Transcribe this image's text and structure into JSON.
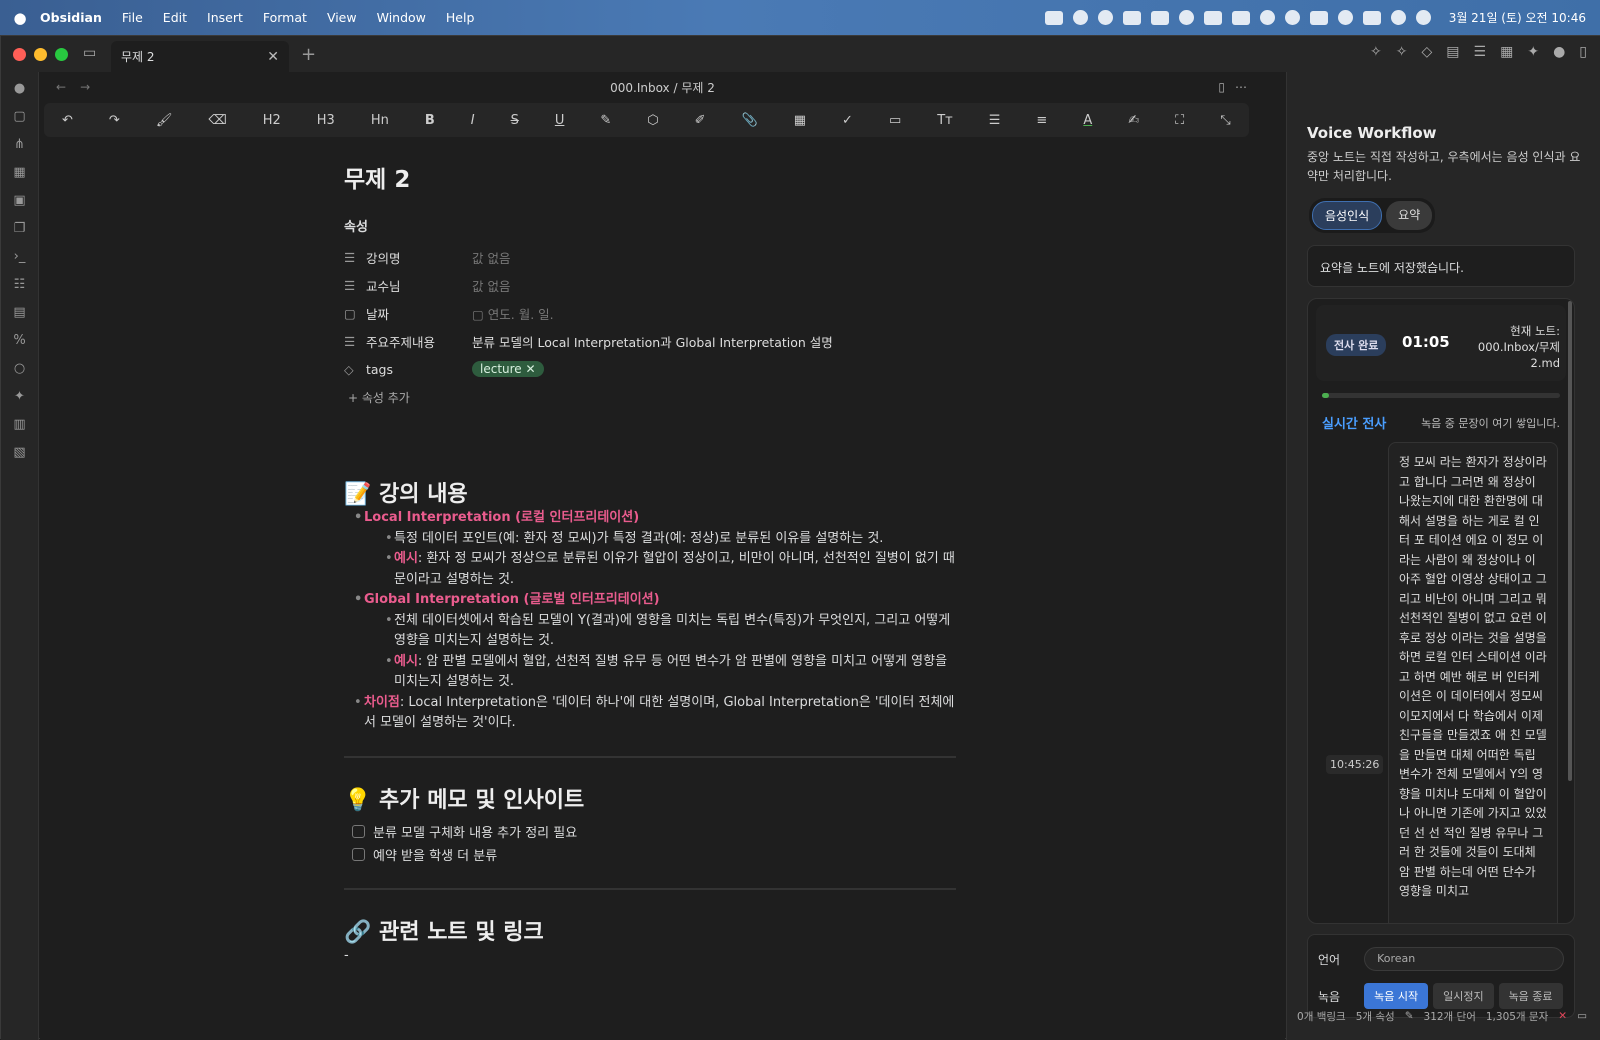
{
  "menubar": {
    "apple": "",
    "app": "Obsidian",
    "items": [
      "File",
      "Edit",
      "Insert",
      "Format",
      "View",
      "Window",
      "Help"
    ],
    "clock": "3월 21일 (토) 오전 10:46"
  },
  "tab": {
    "title": "무제 2",
    "close": "✕",
    "new": "+"
  },
  "nav": {
    "back": "←",
    "forward": "→"
  },
  "breadcrumb": {
    "folder": "000.Inbox",
    "sep": "/",
    "note": "무제 2"
  },
  "toolbar": [
    "↶",
    "↷",
    "🖌",
    "⌫",
    "H2",
    "H3",
    "Hn",
    "B",
    "I",
    "S",
    "U",
    "✎",
    "⬡",
    "✐",
    "📎",
    "▦",
    "✓",
    "▭",
    "Tт",
    "☰",
    "≡",
    "A",
    "✍",
    "⛶",
    "⤡"
  ],
  "note": {
    "title": "무제 2",
    "props_label": "속성",
    "props": [
      {
        "icon": "☰",
        "key": "강의명",
        "value": "값 없음"
      },
      {
        "icon": "☰",
        "key": "교수님",
        "value": "값 없음"
      },
      {
        "icon": "▢",
        "key": "날짜",
        "value": "▢ 연도. 월. 일."
      },
      {
        "icon": "☰",
        "key": "주요주제내용",
        "value": "분류 모델의 Local Interpretation과 Global Interpretation 설명"
      }
    ],
    "tags_key": "tags",
    "tag": "lecture ✕",
    "add_prop": "+ 속성 추가",
    "sec1": "📝 강의 내용",
    "local_head": "Local Interpretation (로컬 인터프리테이션)",
    "local_1": "특정 데이터 포인트(예: 환자 정 모씨)가 특정 결과(예: 정상)로 분류된 이유를 설명하는 것.",
    "ex_label": "예시",
    "local_2": ": 환자 정 모씨가 정상으로 분류된 이유가 혈압이 정상이고, 비만이 아니며, 선천적인 질병이 없기 때문이라고 설명하는 것.",
    "global_head": "Global Interpretation (글로벌 인터프리테이션)",
    "global_1": "전체 데이터셋에서 학습된 모델이 Y(결과)에 영향을 미치는 독립 변수(특징)가 무엇인지, 그리고 어떻게 영향을 미치는지 설명하는 것.",
    "global_2": ": 암 판별 모델에서 혈압, 선천적 질병 유무 등 어떤 변수가 암 판별에 영향을 미치고 어떻게 영향을 미치는지 설명하는 것.",
    "diff_label": "차이점",
    "diff": ": Local Interpretation은 '데이터 하나'에 대한 설명이며, Global Interpretation은 '데이터 전체에서 모델이 설명하는 것'이다.",
    "sec2": "💡 추가 메모 및 인사이트",
    "todo": [
      "분류 모델 구체화 내용 추가 정리 필요",
      "예약 받을 학생 더 분류"
    ],
    "sec3": "🔗 관련 노트 및 링크",
    "dash": "-"
  },
  "side": {
    "title": "Voice Workflow",
    "desc": "중앙 노트는 직접 작성하고, 우측에서는 음성 인식과 요약만 처리합니다.",
    "tabs": [
      "음성인식",
      "요약"
    ],
    "message": "요약을 노트에 저장했습니다.",
    "badge": "전사 완료",
    "timer": "01:05",
    "current_note": "현재 노트: 000.Inbox/무제 2.md",
    "progress": 0.03,
    "live_label": "실시간 전사",
    "live_hint": "녹음 중 문장이 여기 쌓입니다.",
    "timestamp": "10:45:26",
    "transcript": "정 모씨 라는 환자가 정상이라고 합니다 그러면 왜 정상이 나왔는지에 대한 환한명에 대해서 설명을 하는 게로 컬 인터 포 테이션 에요 이 정모 이라는 사람이 왜 정상이나 이 아주 혈압 이영상 상태이고 그리고 비난이 아니며 그리고 뭐 선천적인 질병이 없고 요런 이후로 정상 이라는 것을 설명을 하면 로컬 인터 스테이션 이라고 하면 예반 해로 버 인터케이션은 이 데이터에서 정모씨 이모지에서 다 학습에서 이제 친구들을 만들겠죠 애 친 모델을 만들면 대체 어떠한 독립 변수가 전체 모델에서 Y의 영향을 미치냐 도대체 이 혈압이나 아니면 기존에 가지고 있었던 선 선 적인 질병 유무나 그러 한 것들에 것들이 도대체 암 판별 하는데 어떤 단수가 영향을 미치고",
    "lang_label": "언어",
    "lang_value": "Korean",
    "rec_label": "녹음",
    "btn_start": "녹음 시작",
    "btn_pause": "일시정지",
    "btn_stop": "녹음 종료"
  },
  "status": {
    "backlinks": "0개 백링크",
    "props": "5개 속성",
    "words": "312개 단어",
    "chars": "1,305개 문자"
  }
}
